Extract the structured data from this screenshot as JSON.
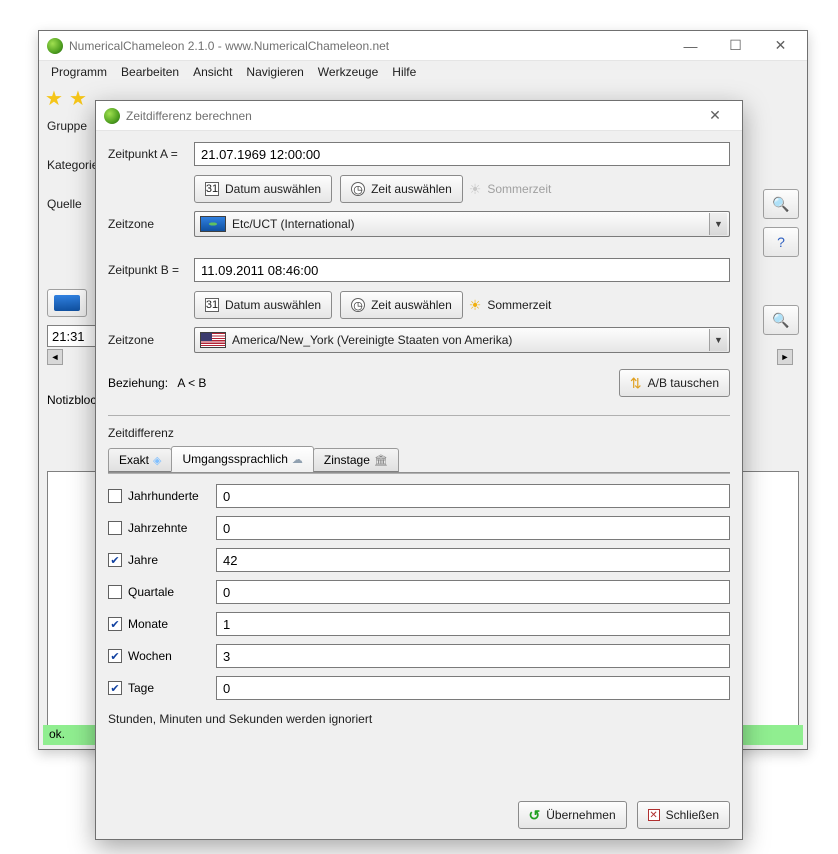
{
  "window": {
    "title": "NumericalChameleon 2.1.0 - www.NumericalChameleon.net",
    "menus": [
      "Programm",
      "Bearbeiten",
      "Ansicht",
      "Navigieren",
      "Werkzeuge",
      "Hilfe"
    ],
    "left_labels": {
      "gruppe": "Gruppe",
      "kategorie": "Kategorie",
      "quelle": "Quelle",
      "notizblock": "Notizbloc"
    },
    "time_box": "21:31",
    "status": "ok."
  },
  "dialog": {
    "title": "Zeitdifferenz berechnen",
    "labels": {
      "zeitpunktA": "Zeitpunkt A =",
      "zeitpunktB": "Zeitpunkt B =",
      "zeitzone": "Zeitzone",
      "datum_btn": "Datum auswählen",
      "zeit_btn": "Zeit auswählen",
      "sommerzeit": "Sommerzeit",
      "beziehung_lbl": "Beziehung:",
      "beziehung_val": "A < B",
      "swap_btn": "A/B tauschen",
      "section": "Zeitdifferenz",
      "tabs": {
        "exakt": "Exakt",
        "umg": "Umgangssprachlich",
        "zins": "Zinstage"
      },
      "note": "Stunden, Minuten und Sekunden werden ignoriert",
      "apply": "Übernehmen",
      "close": "Schließen"
    },
    "pointA": {
      "value": "21.07.1969 12:00:00",
      "sommerzeit_active": false,
      "timezone": "Etc/UCT (International)"
    },
    "pointB": {
      "value": "11.09.2011 08:46:00",
      "sommerzeit_active": true,
      "timezone": "America/New_York (Vereinigte Staaten von Amerika)"
    },
    "diff": [
      {
        "label": "Jahrhunderte",
        "checked": false,
        "value": "0"
      },
      {
        "label": "Jahrzehnte",
        "checked": false,
        "value": "0"
      },
      {
        "label": "Jahre",
        "checked": true,
        "value": "42"
      },
      {
        "label": "Quartale",
        "checked": false,
        "value": "0"
      },
      {
        "label": "Monate",
        "checked": true,
        "value": "1"
      },
      {
        "label": "Wochen",
        "checked": true,
        "value": "3"
      },
      {
        "label": "Tage",
        "checked": true,
        "value": "0"
      }
    ]
  }
}
